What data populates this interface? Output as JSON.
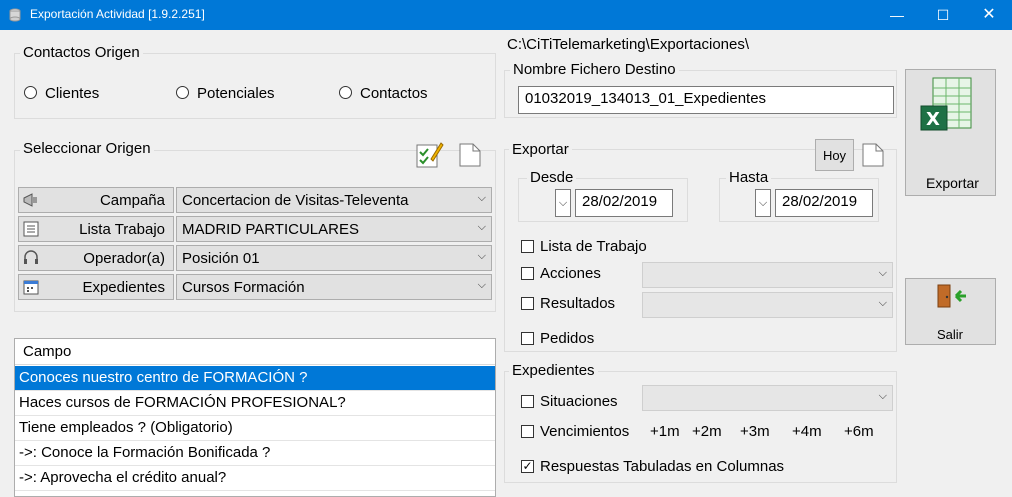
{
  "window": {
    "title": "Exportación Actividad [1.9.2.251]",
    "min": "—",
    "max": "☐",
    "close": "✕"
  },
  "contactos_origen": {
    "legend": "Contactos Origen",
    "options": [
      "Clientes",
      "Potenciales",
      "Contactos"
    ]
  },
  "seleccionar_origen": {
    "legend": "Seleccionar Origen",
    "rows": [
      {
        "label": "Campaña",
        "value": "Concertacion de Visitas-Televenta",
        "icon": "megaphone-icon"
      },
      {
        "label": "Lista Trabajo",
        "value": "MADRID PARTICULARES",
        "icon": "list-icon"
      },
      {
        "label": "Operador(a)",
        "value": "Posición 01",
        "icon": "headset-icon"
      },
      {
        "label": "Expedientes",
        "value": "Cursos Formación",
        "icon": "calendar-icon"
      }
    ]
  },
  "campo_grid": {
    "header": "Campo",
    "rows": [
      "Conoces nuestro centro  de FORMACIÓN ?",
      "Haces cursos de FORMACIÓN PROFESIONAL?",
      "Tiene empleados ? (Obligatorio)",
      "->: Conoce la Formación Bonificada ?",
      "->: Aprovecha el crédito anual?"
    ],
    "selected_index": 0
  },
  "path": "C:\\CiTiTelemarketing\\Exportaciones\\",
  "nombre_fichero": {
    "legend": "Nombre Fichero Destino",
    "value": "01032019_134013_01_Expedientes"
  },
  "exportar": {
    "legend": "Exportar",
    "hoy_label": "Hoy",
    "desde": {
      "legend": "Desde",
      "value": "28/02/2019"
    },
    "hasta": {
      "legend": "Hasta",
      "value": "28/02/2019"
    },
    "lista_trabajo": "Lista de Trabajo",
    "acciones": "Acciones",
    "resultados": "Resultados",
    "pedidos": "Pedidos"
  },
  "expedientes": {
    "legend": "Expedientes",
    "situaciones": "Situaciones",
    "vencimientos": "Vencimientos",
    "offsets": [
      "+1m",
      "+2m",
      "+3m",
      "+4m",
      "+6m"
    ],
    "respuestas": "Respuestas Tabuladas en Columnas",
    "respuestas_checked": true
  },
  "buttons": {
    "exportar": "Exportar",
    "salir": "Salir"
  }
}
